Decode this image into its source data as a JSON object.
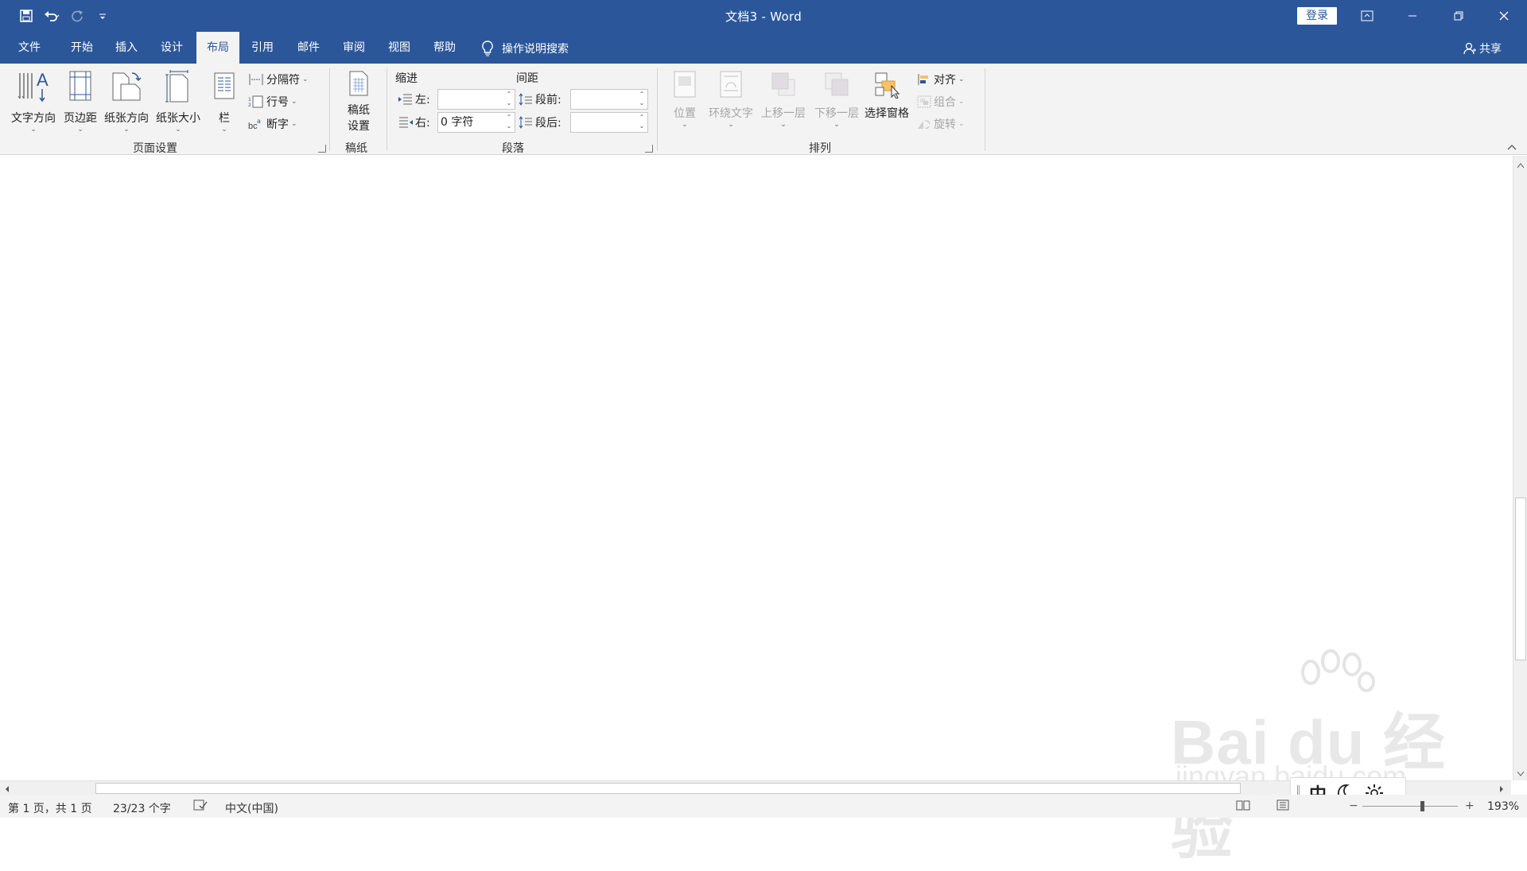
{
  "titlebar": {
    "title": "文档3  -  Word",
    "login_label": "登录",
    "colors": {
      "background": "#2b579a",
      "text": "#ffffff"
    }
  },
  "quick_access": [
    {
      "name": "save-icon"
    },
    {
      "name": "undo-icon"
    },
    {
      "name": "redo-icon"
    },
    {
      "name": "customize-qat-icon"
    }
  ],
  "tabs": [
    {
      "label": "文件"
    },
    {
      "label": "开始"
    },
    {
      "label": "插入"
    },
    {
      "label": "设计"
    },
    {
      "label": "布局",
      "active": true
    },
    {
      "label": "引用"
    },
    {
      "label": "邮件"
    },
    {
      "label": "审阅"
    },
    {
      "label": "视图"
    },
    {
      "label": "帮助"
    }
  ],
  "tell_me": "操作说明搜索",
  "share": "共享",
  "ribbon": {
    "page_setup": {
      "label": "页面设置",
      "text_direction": "文字方向",
      "margins": "页边距",
      "orientation": "纸张方向",
      "size": "纸张大小",
      "columns": "栏",
      "breaks": "分隔符",
      "line_numbers": "行号",
      "hyphenation": "断字"
    },
    "manuscript": {
      "label": "稿纸",
      "setup_line1": "稿纸",
      "setup_line2": "设置"
    },
    "paragraph": {
      "label": "段落",
      "indent_title": "缩进",
      "spacing_title": "间距",
      "left_label": "左:",
      "left_value": "",
      "right_label": "右:",
      "right_value": "0 字符",
      "before_label": "段前:",
      "before_value": "",
      "after_label": "段后:",
      "after_value": ""
    },
    "arrange": {
      "label": "排列",
      "position": "位置",
      "wrap_text": "环绕文字",
      "bring_forward": "上移一层",
      "send_backward": "下移一层",
      "selection_pane": "选择窗格",
      "align": "对齐",
      "group": "组合",
      "rotate": "旋转"
    }
  },
  "statusbar": {
    "page": "第 1 页，共 1 页",
    "words": "23/23 个字",
    "language": "中文(中国)",
    "zoom": "193%"
  },
  "ime": {
    "mode": "中"
  },
  "watermark": {
    "main": "Bai du 经验",
    "sub": "jingyan.baidu.com"
  }
}
